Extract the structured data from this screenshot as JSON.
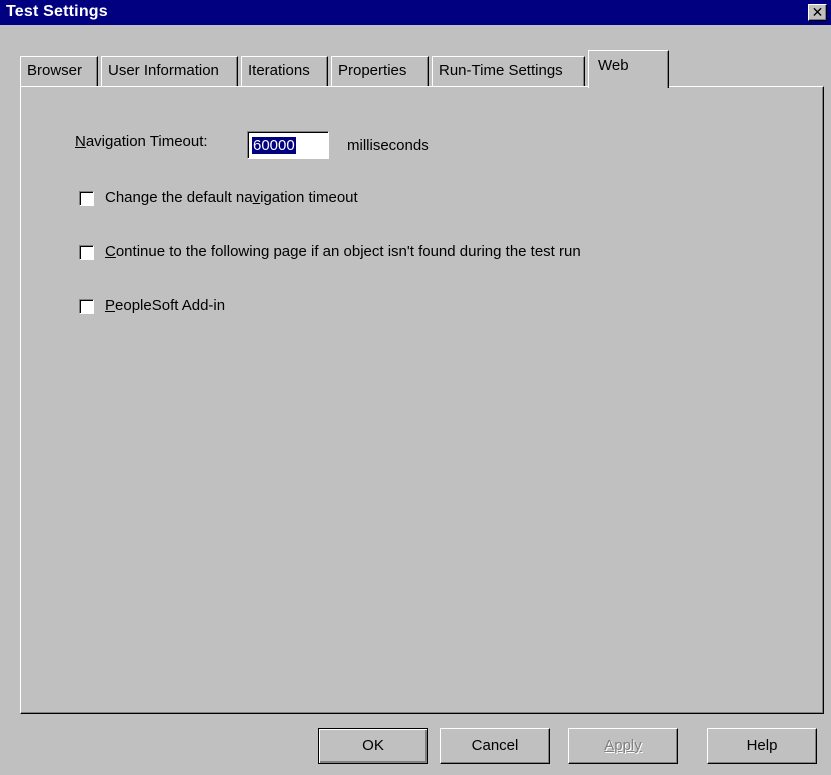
{
  "window": {
    "title": "Test Settings",
    "close_glyph": "✕"
  },
  "tabs": [
    {
      "label": "Browser",
      "active": false
    },
    {
      "label": "User Information",
      "active": false
    },
    {
      "label": "Iterations",
      "active": false
    },
    {
      "label": "Properties",
      "active": false
    },
    {
      "label": "Run-Time Settings",
      "active": false
    },
    {
      "label": "Web",
      "active": true
    }
  ],
  "web": {
    "timeout_label_mnemonic": "N",
    "timeout_label_rest": "avigation Timeout:",
    "timeout_value": "60000",
    "timeout_unit": "milliseconds",
    "options": [
      {
        "pre": "Change the default na",
        "mnemonic": "v",
        "post": "igation timeout",
        "checked": false
      },
      {
        "pre": "",
        "mnemonic": "C",
        "post": "ontinue to the following page if an object isn't found during the test run",
        "checked": false
      },
      {
        "pre": "",
        "mnemonic": "P",
        "post": "eopleSoft Add-in",
        "checked": false
      }
    ]
  },
  "buttons": {
    "ok": "OK",
    "cancel": "Cancel",
    "apply": "Apply",
    "help": "Help"
  }
}
